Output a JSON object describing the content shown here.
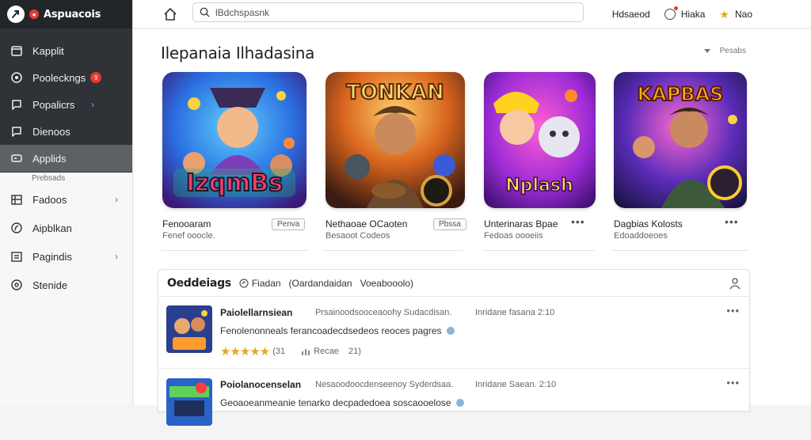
{
  "app": {
    "title": "Aspuacois"
  },
  "sidebar": {
    "primary": [
      {
        "label": "Kapplit",
        "icon": "calendar-icon"
      },
      {
        "label": "Pooleckngs",
        "icon": "chat-icon",
        "badge": "9"
      },
      {
        "label": "Popalicrs",
        "icon": "chat-bubble-icon"
      },
      {
        "label": "Dienoos",
        "icon": "chat-bubble-icon"
      },
      {
        "label": "Applids",
        "icon": "gamepad-icon"
      }
    ],
    "caption": "Prebsads",
    "secondary": [
      {
        "label": "Fadoos",
        "icon": "grid-icon"
      },
      {
        "label": "Aipblkan",
        "icon": "compass-icon"
      },
      {
        "label": "Pagindis",
        "icon": "list-icon"
      },
      {
        "label": "Stenide",
        "icon": "settings-icon"
      }
    ]
  },
  "topbar": {
    "search_value": "lBdchspasnk",
    "items": [
      {
        "label": "Hdsaeod"
      },
      {
        "label": "Hiaka",
        "icon": "notification-icon"
      },
      {
        "label": "Nao",
        "icon": "star-icon"
      }
    ]
  },
  "featured": {
    "title": "Ilepanaia Ilhadasina",
    "filter": "Pesabs",
    "cards": [
      {
        "title": "Fenooaram",
        "subtitle": "Fenef ooocle.",
        "pill": "Penva",
        "art_text": "IzqmBs"
      },
      {
        "title": "Nethaoae OCaoten",
        "subtitle": "Besaoot Codeos",
        "pill": "Pbssa",
        "art_text": "TONKAN"
      },
      {
        "title": "Unterinaras Bpae",
        "subtitle": "Fedoas oooeiis",
        "art_text": "Nplash"
      },
      {
        "title": "Dagbias Kolosts",
        "subtitle": "Edoaddoeoes",
        "art_text": "KAPBAS"
      }
    ]
  },
  "list": {
    "title": "Oeddeiags",
    "filter_label": "Fiadan",
    "filter_extra": "(Oardandaidan",
    "filter_extra2": "Voeabooolo)",
    "rows": [
      {
        "title": "Paiolellarnsiean",
        "meta": "Prsainoodsooceaoohy Sudacdisan.",
        "meta2": "Inridane fasana 2:10",
        "desc": "Fenolenonneals ferancoadecdsedeos reoces pagres",
        "rating_count": "(31",
        "tag": "Recae",
        "tag_count": "21)"
      },
      {
        "title": "Poiolanocenselan",
        "meta": "Nesaoodoocdenseenoy Syderdsaa.",
        "meta2": "Inridane Saean. 2:10",
        "desc": "Geoaoeanmeanie tenarko decpadedoea soscaooelose"
      }
    ]
  }
}
